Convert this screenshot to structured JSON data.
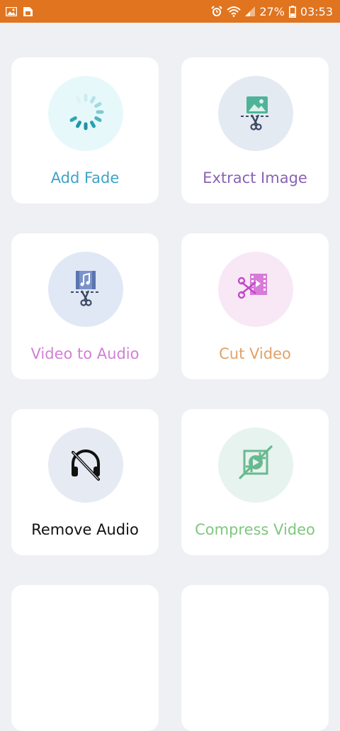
{
  "status_bar": {
    "battery_percent": "27%",
    "time": "03:53",
    "icons": [
      "image-icon",
      "sim-icon",
      "alarm-icon",
      "wifi-icon",
      "signal-icon",
      "battery-icon"
    ]
  },
  "tools": [
    {
      "label": "Add Fade",
      "label_color": "#3fa3c9",
      "circle_color": "#e7f8fb",
      "icon": "fade-spinner-icon"
    },
    {
      "label": "Extract Image",
      "label_color": "#8a63b5",
      "circle_color": "#e4eaf2",
      "icon": "image-scissors-icon"
    },
    {
      "label": "Video to Audio",
      "label_color": "#d27fd6",
      "circle_color": "#e0e8f5",
      "icon": "video-audio-scissors-icon"
    },
    {
      "label": "Cut Video",
      "label_color": "#e0a268",
      "circle_color": "#f8e8f6",
      "icon": "film-scissors-icon"
    },
    {
      "label": "Remove Audio",
      "label_color": "#111111",
      "circle_color": "#e6eaf3",
      "icon": "headphones-off-icon"
    },
    {
      "label": "Compress Video",
      "label_color": "#7fc77f",
      "circle_color": "#e7f3ef",
      "icon": "compress-icon"
    }
  ]
}
